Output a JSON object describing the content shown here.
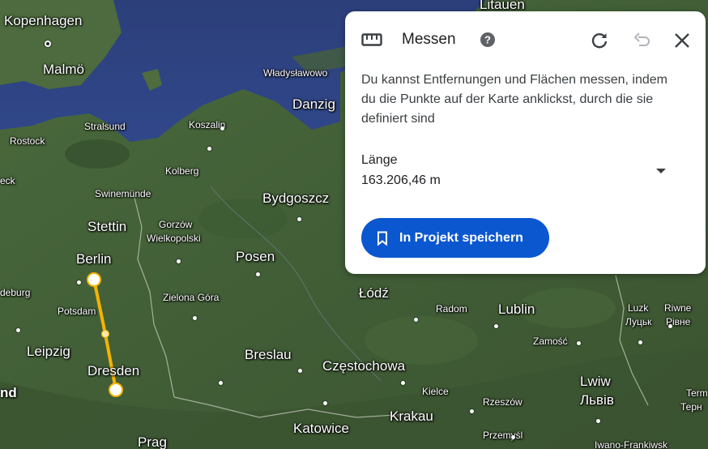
{
  "map": {
    "labels": {
      "kopenhagen": "Kopenhagen",
      "malmo": "Malmö",
      "litauen": "Litauen",
      "wladyslawowo": "Władysławowo",
      "danzig": "Danzig",
      "stralsund": "Stralsund",
      "koszalin": "Koszalin",
      "rostock": "Rostock",
      "kolberg": "Kolberg",
      "eck": "eck",
      "swinemunde": "Swinemünde",
      "bydgoszcz": "Bydgoszcz",
      "stettin": "Stettin",
      "gorzow": "Gorzów",
      "wielkopolski": "Wielkopolski",
      "berlin": "Berlin",
      "posen": "Posen",
      "lodz": "Łódź",
      "deburg": "deburg",
      "potsdam": "Potsdam",
      "zielona_gora": "Zielona Góra",
      "radom": "Radom",
      "lublin": "Lublin",
      "luzk": "Luzk",
      "luzk_cyr": "Луцьк",
      "rivne": "Riwne",
      "rivne_cyr": "Рівне",
      "leipzig": "Leipzig",
      "zamosc": "Zamość",
      "breslau": "Breslau",
      "czestochowa": "Częstochowa",
      "dresden": "Dresden",
      "lwiw": "Lwiw",
      "lwiw_cyr": "Львів",
      "nd": "nd",
      "kielce": "Kielce",
      "rzeszow": "Rzeszów",
      "term": "Term",
      "term_cyr": "Терн",
      "katowice": "Katowice",
      "krakau": "Krakau",
      "przemysl": "Przemyśl",
      "prag": "Prag",
      "ivano": "Iwano-Frankiwsk"
    },
    "route_color": "#f4b400"
  },
  "panel": {
    "title": "Messen",
    "description": "Du kannst Entfernungen und Flächen messen, indem du die Punkte auf der Karte anklickst, durch die sie definiert sind",
    "length_label": "Länge",
    "length_value": "163.206,46 m",
    "save_button_label": "In Projekt speichern",
    "icons": {
      "ruler": "ruler-icon",
      "help": "help-icon",
      "refresh": "refresh-icon",
      "undo": "undo-icon",
      "close": "close-icon",
      "dropdown": "chevron-down-icon",
      "bookmark": "bookmark-icon"
    },
    "colors": {
      "accent": "#0b57d0",
      "text": "#202124"
    }
  }
}
